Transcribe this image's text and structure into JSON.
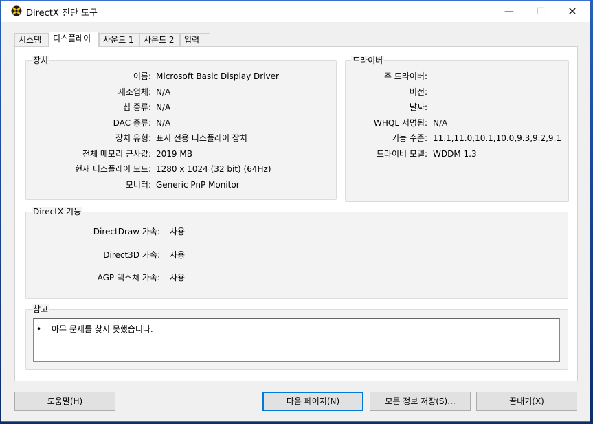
{
  "window": {
    "title": "DirectX 진단 도구",
    "minimize_glyph": "—",
    "maximize_glyph": "☐",
    "close_glyph": "✕"
  },
  "tabs": [
    {
      "label": "시스템",
      "active": false
    },
    {
      "label": "디스플레이",
      "active": true
    },
    {
      "label": "사운드 1",
      "active": false
    },
    {
      "label": "사운드 2",
      "active": false
    },
    {
      "label": "입력",
      "active": false
    }
  ],
  "device": {
    "title": "장치",
    "rows": [
      {
        "label": "이름:",
        "value": "Microsoft Basic Display Driver"
      },
      {
        "label": "제조업체:",
        "value": "N/A"
      },
      {
        "label": "칩 종류:",
        "value": "N/A"
      },
      {
        "label": "DAC 종류:",
        "value": "N/A"
      },
      {
        "label": "장치 유형:",
        "value": "표시 전용 디스플레이 장치"
      },
      {
        "label": "전체 메모리 근사값:",
        "value": "2019 MB"
      },
      {
        "label": "현재 디스플레이 모드:",
        "value": "1280 x 1024 (32 bit) (64Hz)"
      },
      {
        "label": "모니터:",
        "value": "Generic PnP Monitor"
      }
    ]
  },
  "driver": {
    "title": "드라이버",
    "rows": [
      {
        "label": "주 드라이버:",
        "value": ""
      },
      {
        "label": "버전:",
        "value": ""
      },
      {
        "label": "날짜:",
        "value": ""
      },
      {
        "label": "WHQL 서명됨:",
        "value": "N/A"
      },
      {
        "label": "기능 수준:",
        "value": "11.1,11.0,10.1,10.0,9.3,9.2,9.1"
      },
      {
        "label": "드라이버 모델:",
        "value": "WDDM 1.3"
      }
    ]
  },
  "features": {
    "title": "DirectX 기능",
    "rows": [
      {
        "label": "DirectDraw 가속:",
        "value": "사용"
      },
      {
        "label": "Direct3D 가속:",
        "value": "사용"
      },
      {
        "label": "AGP 텍스처 가속:",
        "value": "사용"
      }
    ]
  },
  "notes": {
    "title": "참고",
    "bullet": "•",
    "items": [
      "아무 문제를 찾지 못했습니다."
    ]
  },
  "buttons": {
    "help": "도움말(H)",
    "next_page": "다음 페이지(N)",
    "save_all": "모든 정보 저장(S)...",
    "exit": "끝내기(X)"
  }
}
